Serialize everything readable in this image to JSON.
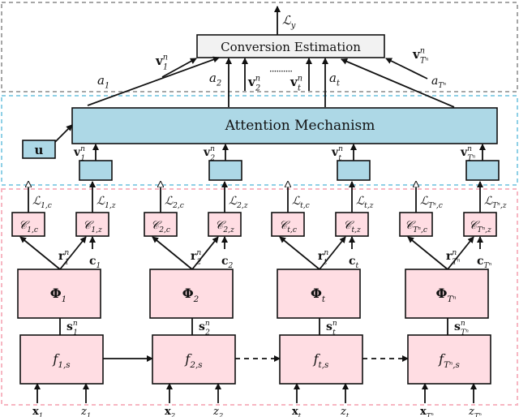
{
  "colors": {
    "top_region_border": "#a6a6a6",
    "attention_region_border": "#8fd0e6",
    "lower_region_border": "#f7b6c2",
    "conversion_box_fill": "#f2f2f2",
    "attention_fill": "#add8e6",
    "pink_fill": "#ffdde3",
    "stroke": "#111111"
  },
  "top": {
    "output_loss": {
      "base": "ℒ",
      "sub": "y"
    },
    "conversion_box_label": "Conversion Estimation",
    "v_first": {
      "base": "v",
      "sup": "n",
      "sub": "1"
    },
    "v_last": {
      "base": "v",
      "sup": "n",
      "sub": "Tⁿ"
    },
    "a_first": {
      "base": "a",
      "sub": "1"
    },
    "a_second": {
      "base": "a",
      "sub": "2"
    },
    "v_second": {
      "base": "v",
      "sup": "n",
      "sub": "2"
    },
    "ellipsis": "··········",
    "v_t": {
      "base": "v",
      "sup": "n",
      "sub": "t"
    },
    "a_t": {
      "base": "a",
      "sub": "t"
    },
    "a_last": {
      "base": "a",
      "sub": "Tⁿ"
    }
  },
  "attention": {
    "label": "Attention Mechanism",
    "u_label": "u"
  },
  "columns": [
    {
      "v": {
        "base": "v",
        "sup": "n",
        "sub": "1"
      },
      "Lc": {
        "base": "ℒ",
        "sub": "1,c"
      },
      "Lz": {
        "base": "ℒ",
        "sub": "1,z"
      },
      "Cc": {
        "base": "𝒞",
        "sub": "1,c"
      },
      "Cz": {
        "base": "𝒞",
        "sub": "1,z"
      },
      "r": {
        "base": "r",
        "sup": "n",
        "sub": "1"
      },
      "c": {
        "base": "c",
        "sub": "1"
      },
      "phi": {
        "base": "Φ",
        "sub": "1"
      },
      "s": {
        "base": "s",
        "sup": "n",
        "sub": "1"
      },
      "f": {
        "base": "f",
        "sub": "1,s"
      },
      "x": {
        "base": "x",
        "sub": "1"
      },
      "z": {
        "base": "z",
        "sub": "1"
      }
    },
    {
      "v": {
        "base": "v",
        "sup": "n",
        "sub": "2"
      },
      "Lc": {
        "base": "ℒ",
        "sub": "2,c"
      },
      "Lz": {
        "base": "ℒ",
        "sub": "2,z"
      },
      "Cc": {
        "base": "𝒞",
        "sub": "2,c"
      },
      "Cz": {
        "base": "𝒞",
        "sub": "2,z"
      },
      "r": {
        "base": "r",
        "sup": "n",
        "sub": "2"
      },
      "c": {
        "base": "c",
        "sub": "2"
      },
      "phi": {
        "base": "Φ",
        "sub": "2"
      },
      "s": {
        "base": "s",
        "sup": "n",
        "sub": "2"
      },
      "f": {
        "base": "f",
        "sub": "2,s"
      },
      "x": {
        "base": "x",
        "sub": "2"
      },
      "z": {
        "base": "z",
        "sub": "2"
      }
    },
    {
      "v": {
        "base": "v",
        "sup": "n",
        "sub": "t"
      },
      "Lc": {
        "base": "ℒ",
        "sub": "t,c"
      },
      "Lz": {
        "base": "ℒ",
        "sub": "t,z"
      },
      "Cc": {
        "base": "𝒞",
        "sub": "t,c"
      },
      "Cz": {
        "base": "𝒞",
        "sub": "t,z"
      },
      "r": {
        "base": "r",
        "sup": "n",
        "sub": "t"
      },
      "c": {
        "base": "c",
        "sub": "t"
      },
      "phi": {
        "base": "Φ",
        "sub": "t"
      },
      "s": {
        "base": "s",
        "sup": "n",
        "sub": "t"
      },
      "f": {
        "base": "f",
        "sub": "t,s"
      },
      "x": {
        "base": "x",
        "sub": "t"
      },
      "z": {
        "base": "z",
        "sub": "t"
      }
    },
    {
      "v": {
        "base": "v",
        "sup": "n",
        "sub": "Tⁿ"
      },
      "Lc": {
        "base": "ℒ",
        "sub": "Tⁿ,c"
      },
      "Lz": {
        "base": "ℒ",
        "sub": "Tⁿ,z"
      },
      "Cc": {
        "base": "𝒞",
        "sub": "Tⁿ,c"
      },
      "Cz": {
        "base": "𝒞",
        "sub": "Tⁿ,z"
      },
      "r": {
        "base": "r",
        "sup": "n",
        "sub": "Tⁿ"
      },
      "c": {
        "base": "c",
        "sub": "Tⁿ"
      },
      "phi": {
        "base": "Φ",
        "sub": "Tⁿ"
      },
      "s": {
        "base": "s",
        "sup": "n",
        "sub": "Tⁿ"
      },
      "f": {
        "base": "f",
        "sub": "Tⁿ,s"
      },
      "x": {
        "base": "x",
        "sub": "Tⁿ"
      },
      "z": {
        "base": "z",
        "sub": "Tⁿ"
      }
    }
  ],
  "chain_edges": [
    "solid",
    "dashed",
    "dashed"
  ]
}
